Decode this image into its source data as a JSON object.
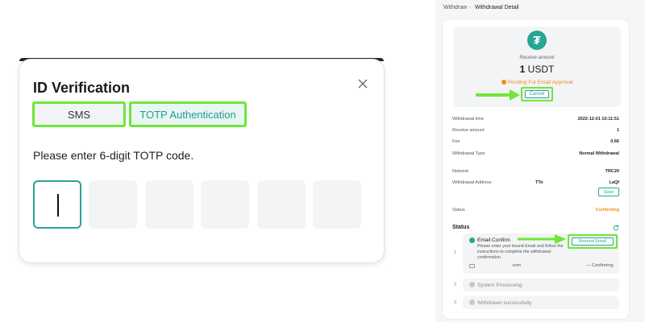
{
  "modal": {
    "title": "ID Verification",
    "tabs": [
      {
        "label": "SMS",
        "selected": false
      },
      {
        "label": "TOTP Authentication",
        "selected": true
      }
    ],
    "prompt": "Please enter 6-digit TOTP code.",
    "code_digits": [
      "",
      "",
      "",
      "",
      "",
      ""
    ]
  },
  "breadcrumb": {
    "parent": "Withdraw",
    "separator": "›",
    "current": "Withdrawal Detail"
  },
  "receive": {
    "label": "Receive amount",
    "amount": "1",
    "currency": "USDT",
    "status": "Pending For Email Approval",
    "cancel_label": "Cancel"
  },
  "details": [
    {
      "label": "Withdrawal time",
      "value": "2022-12-01 10:11:51"
    },
    {
      "label": "Receive amount",
      "value": "1"
    },
    {
      "label": "Fee",
      "value": "0.66"
    },
    {
      "label": "Withdrawal Type",
      "value": "Normal Withdrawal"
    },
    {
      "label": "Network",
      "value": "TRC20"
    }
  ],
  "address": {
    "label": "Withdrawal Address",
    "prefix": "TTo",
    "suffix": "LaQf",
    "save_label": "Save"
  },
  "status_row": {
    "label": "Status",
    "value": "Confirming"
  },
  "status_section": {
    "title": "Status",
    "steps": [
      {
        "number": "1",
        "title": "Email Confirm",
        "description": "Please enter your bound Email and follow the instructions to complete the withdrawal confirmation.",
        "email": ".com",
        "state": "— Confirming",
        "resend_label": "Resend Email"
      },
      {
        "number": "2",
        "title": "System Processing"
      },
      {
        "number": "3",
        "title": "Withdrawn successfully"
      }
    ]
  },
  "colors": {
    "accent": "#27a596",
    "highlight": "#6ee63a",
    "warning": "#f08a1c"
  }
}
